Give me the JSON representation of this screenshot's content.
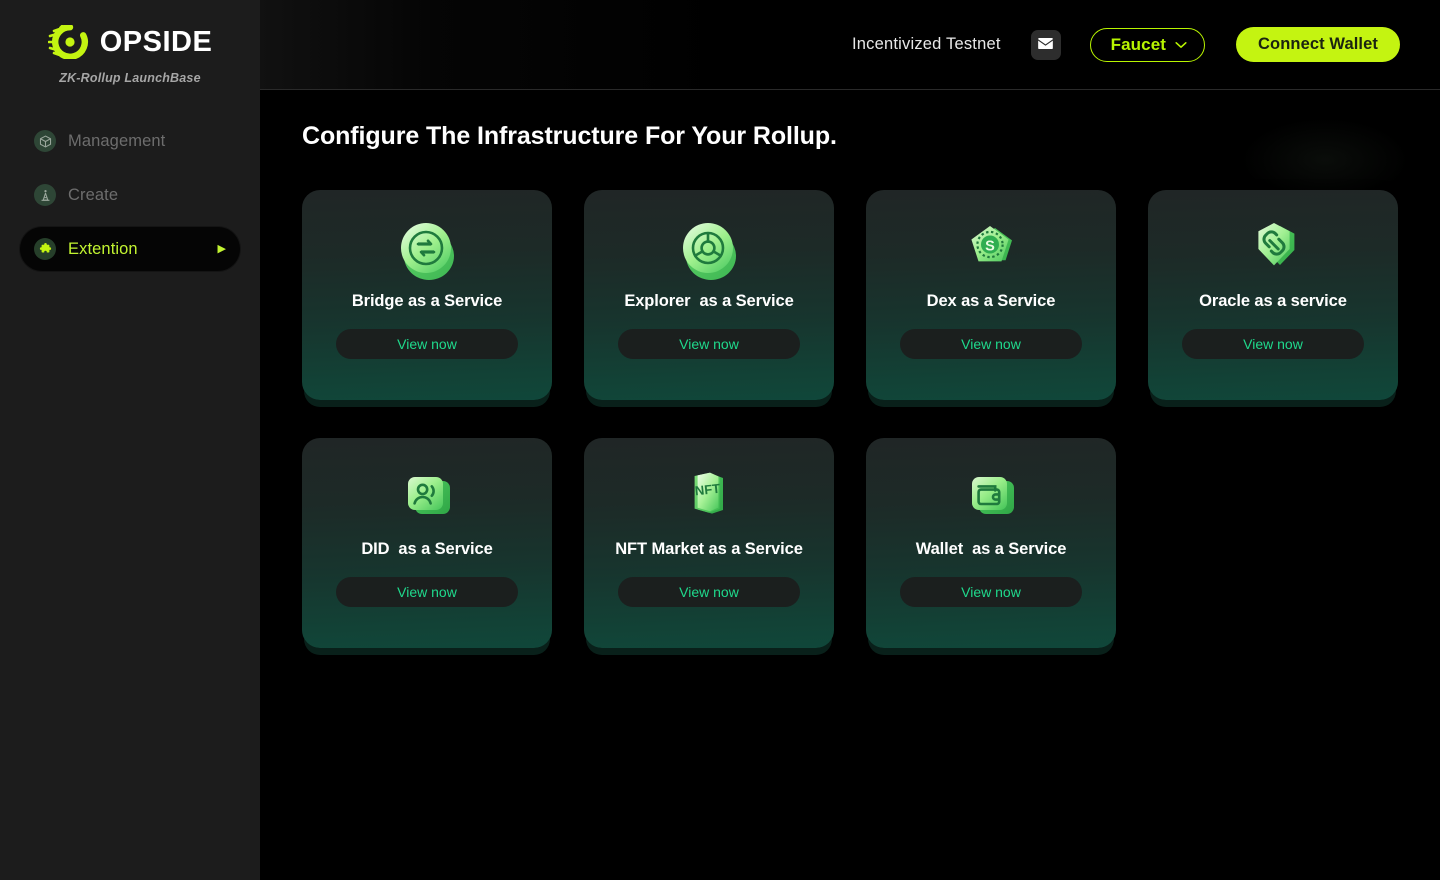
{
  "sidebar": {
    "brand": {
      "name": "OPSIDE",
      "tagline": "ZK-Rollup LaunchBase",
      "logo_icon": "opside-logo-icon"
    },
    "items": [
      {
        "label": "Management",
        "icon": "box-3d-icon",
        "active": false
      },
      {
        "label": "Create",
        "icon": "tower-icon",
        "active": false
      },
      {
        "label": "Extention",
        "icon": "puzzle-piece-icon",
        "active": true,
        "arrow": "▶"
      }
    ]
  },
  "topbar": {
    "network_label": "Incentivized Testnet",
    "mail_icon": "envelope-icon",
    "faucet_label": "Faucet",
    "faucet_chevron": "chevron-down-icon",
    "connect_label": "Connect Wallet"
  },
  "main": {
    "title": "Configure The Infrastructure For Your Rollup.",
    "cards": [
      {
        "title": "Bridge as a Service",
        "icon": "bridge-swap-coin-icon",
        "cta": "View now"
      },
      {
        "title": "Explorer  as a Service",
        "icon": "explorer-coin-icon",
        "cta": "View now"
      },
      {
        "title": "Dex as a Service",
        "icon": "dex-pentagon-coin-icon",
        "cta": "View now"
      },
      {
        "title": "Oracle as a service",
        "icon": "oracle-shield-link-icon",
        "cta": "View now"
      },
      {
        "title": "DID  as a Service",
        "icon": "did-person-card-icon",
        "cta": "View now"
      },
      {
        "title": "NFT Market as a Service",
        "icon": "nft-books-icon",
        "cta": "View now"
      },
      {
        "title": "Wallet  as a Service",
        "icon": "wallet-icon",
        "cta": "View now"
      }
    ]
  },
  "colors": {
    "accent_lime": "#c4f411",
    "accent_green": "#1fd98c",
    "sidebar_bg": "#1c1c1c",
    "page_bg": "#000000",
    "card_top": "#202626",
    "card_bottom": "#10473a",
    "muted_text": "#6d6d6d"
  }
}
